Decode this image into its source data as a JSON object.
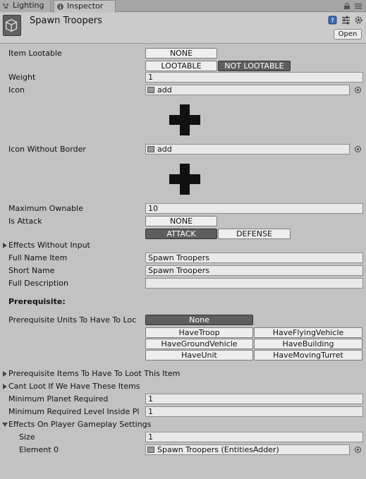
{
  "tabs": [
    {
      "label": "Lighting"
    },
    {
      "label": "Inspector"
    }
  ],
  "header": {
    "title": "Spawn Troopers",
    "open_label": "Open"
  },
  "item_lootable": {
    "label": "Item Lootable",
    "none_label": "NONE",
    "lootable_label": "LOOTABLE",
    "not_lootable_label": "NOT  LOOTABLE",
    "selected": "NOT  LOOTABLE"
  },
  "weight": {
    "label": "Weight",
    "value": "1"
  },
  "icon": {
    "label": "Icon",
    "value": "add"
  },
  "icon_without_border": {
    "label": "Icon Without Border",
    "value": "add"
  },
  "maximum_ownable": {
    "label": "Maximum Ownable",
    "value": "10"
  },
  "is_attack": {
    "label": "Is Attack",
    "none_label": "NONE",
    "attack_label": "ATTACK",
    "defense_label": "DEFENSE",
    "selected": "ATTACK"
  },
  "effects_without_input": {
    "label": "Effects Without Input"
  },
  "full_name_item": {
    "label": "Full Name Item",
    "value": "Spawn Troopers"
  },
  "short_name": {
    "label": "Short Name",
    "value": "Spawn Troopers"
  },
  "full_description": {
    "label": "Full Description",
    "value": ""
  },
  "prerequisite": {
    "heading": "Prerequisite:",
    "units_label": "Prerequisite Units To Have To Loc",
    "none_label": "None",
    "options": [
      "HaveTroop",
      "HaveFlyingVehicle",
      "HaveGroundVehicle",
      "HaveBuilding",
      "HaveUnit",
      "HaveMovingTurret"
    ]
  },
  "prerequisite_items": {
    "label": "Prerequisite Items To Have To Loot This Item"
  },
  "cant_loot": {
    "label": "Cant Loot If We Have These Items"
  },
  "minimum_planet": {
    "label": "Minimum Planet Required",
    "value": "1"
  },
  "minimum_level": {
    "label": "Minimum Required Level Inside Pl",
    "value": "1"
  },
  "effects_on_player": {
    "label": "Effects On Player Gameplay Settings",
    "size_label": "Size",
    "size_value": "1",
    "element_label": "Element 0",
    "element_value": "Spawn Troopers (EntitiesAdder)"
  },
  "colors": {
    "background": "#c2c2c2",
    "selected_button": "#5e5e5e",
    "field": "#e9e9e9"
  }
}
